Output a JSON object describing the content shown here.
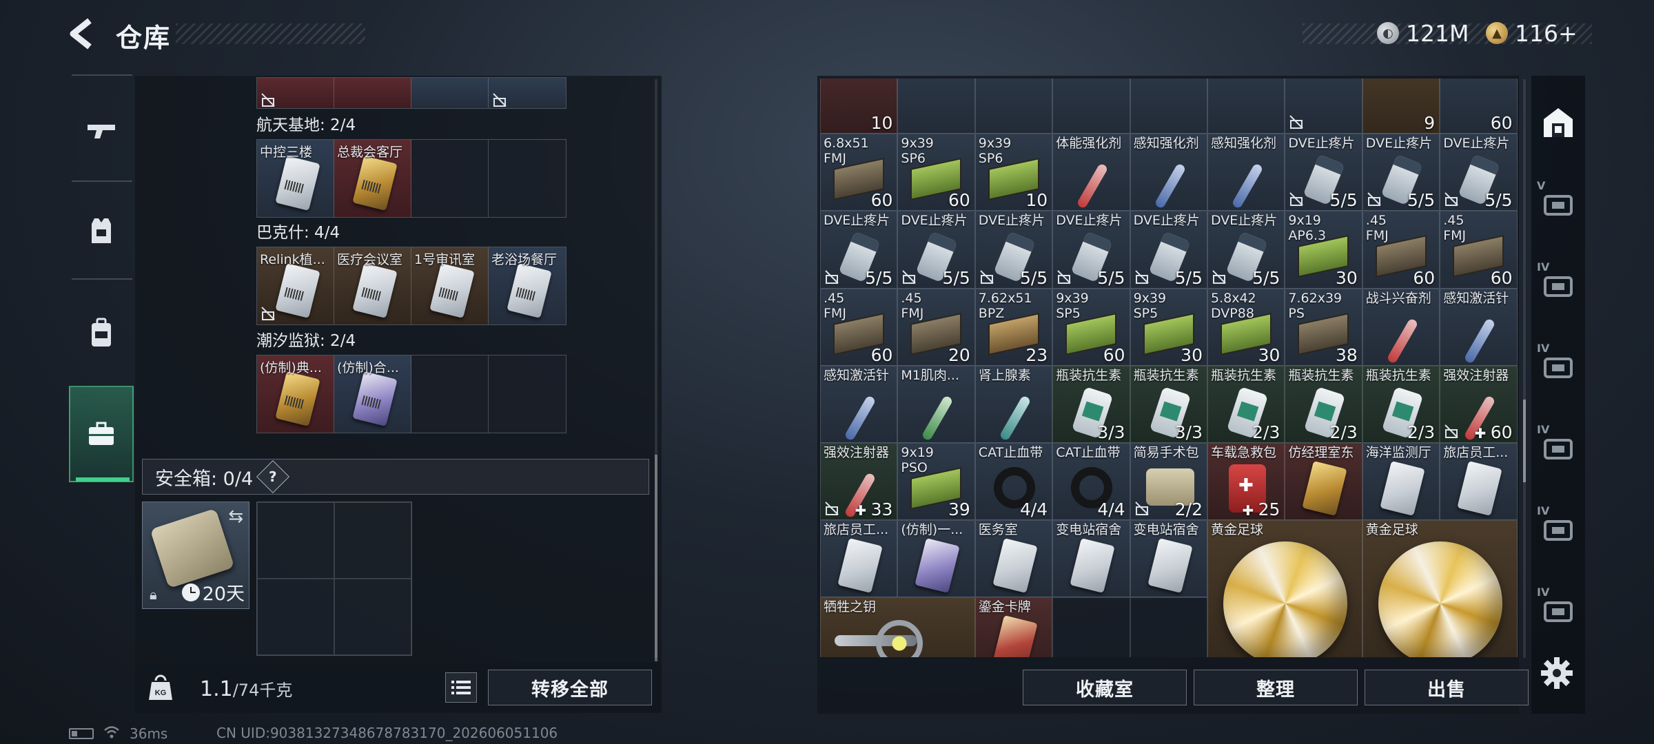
{
  "header": {
    "title": "仓库",
    "currency": [
      {
        "icon": "silver-coin-icon",
        "value": "121M"
      },
      {
        "icon": "gold-coin-icon",
        "value": "116+"
      }
    ]
  },
  "left_nav": [
    {
      "icon": "gun-icon",
      "active": false
    },
    {
      "icon": "vest-icon",
      "active": false
    },
    {
      "icon": "backpack-icon",
      "active": false
    },
    {
      "icon": "briefcase-icon",
      "active": true
    }
  ],
  "key_groups": [
    {
      "label": "航天基地: 2/4",
      "cells": [
        {
          "name": "中控三楼",
          "card": "white",
          "bg": "blue"
        },
        {
          "name": "总裁会客厅",
          "card": "gold",
          "bg": "red"
        },
        {
          "name": "",
          "card": "",
          "bg": "empty"
        },
        {
          "name": "",
          "card": "",
          "bg": "empty"
        }
      ]
    },
    {
      "label": "巴克什: 4/4",
      "cells": [
        {
          "name": "Relink植...",
          "card": "white",
          "bg": "brown",
          "locked": true
        },
        {
          "name": "医疗会议室",
          "card": "white",
          "bg": "brown"
        },
        {
          "name": "1号审讯室",
          "card": "white",
          "bg": "brown"
        },
        {
          "name": "老浴场餐厅",
          "card": "white",
          "bg": "blue"
        }
      ]
    },
    {
      "label": "潮汐监狱: 2/4",
      "cells": [
        {
          "name": "(仿制)典...",
          "card": "gold",
          "bg": "red"
        },
        {
          "name": "(仿制)合...",
          "card": "purple",
          "bg": "blue"
        },
        {
          "name": "",
          "card": "",
          "bg": "empty"
        },
        {
          "name": "",
          "card": "",
          "bg": "empty"
        }
      ]
    }
  ],
  "safe_box": {
    "label": "安全箱: 0/4",
    "help": "?",
    "timer": "20天"
  },
  "footer_left": {
    "weight_value": "1.1",
    "weight_max": "/74千克",
    "transfer_all": "转移全部"
  },
  "footer_right": {
    "collection": "收藏室",
    "organize": "整理",
    "sell": "出售"
  },
  "inventory": [
    {
      "row": 0,
      "col": 0,
      "name": "",
      "qty": "10",
      "kind": "ammo-partial",
      "color": "red"
    },
    {
      "row": 0,
      "col": 1,
      "name": "",
      "qty": "",
      "kind": "partial",
      "color": "blue"
    },
    {
      "row": 0,
      "col": 2,
      "name": "",
      "qty": "",
      "kind": "partial",
      "color": "blue"
    },
    {
      "row": 0,
      "col": 3,
      "name": "",
      "qty": "",
      "kind": "partial",
      "color": "blue"
    },
    {
      "row": 0,
      "col": 4,
      "name": "",
      "qty": "",
      "kind": "partial",
      "color": "blue"
    },
    {
      "row": 0,
      "col": 5,
      "name": "",
      "qty": "",
      "kind": "partial",
      "color": "blue"
    },
    {
      "row": 0,
      "col": 6,
      "name": "",
      "qty": "",
      "kind": "partial",
      "color": "blue",
      "locked": true
    },
    {
      "row": 0,
      "col": 7,
      "name": "",
      "qty": "9",
      "kind": "ammo-partial",
      "color": "gold"
    },
    {
      "row": 0,
      "col": 8,
      "name": "",
      "qty": "60",
      "kind": "ammo-partial",
      "color": "blue"
    },
    {
      "row": 1,
      "col": 0,
      "name": "6.8x51\nFMJ",
      "qty": "60",
      "kind": "ammo",
      "ammo": "brown",
      "color": "blue"
    },
    {
      "row": 1,
      "col": 1,
      "name": "9x39\nSP6",
      "qty": "60",
      "kind": "ammo",
      "ammo": "green",
      "color": "blue"
    },
    {
      "row": 1,
      "col": 2,
      "name": "9x39\nSP6",
      "qty": "10",
      "kind": "ammo",
      "ammo": "green",
      "color": "blue"
    },
    {
      "row": 1,
      "col": 3,
      "name": "体能强化剂",
      "qty": "",
      "kind": "syringe",
      "syr": "red",
      "color": "blue"
    },
    {
      "row": 1,
      "col": 4,
      "name": "感知强化剂",
      "qty": "",
      "kind": "syringe",
      "syr": "blue",
      "color": "blue"
    },
    {
      "row": 1,
      "col": 5,
      "name": "感知强化剂",
      "qty": "",
      "kind": "syringe",
      "syr": "blue",
      "color": "blue"
    },
    {
      "row": 1,
      "col": 6,
      "name": "DVE止疼片",
      "qty": "5/5",
      "kind": "pill",
      "color": "blue",
      "locked": true
    },
    {
      "row": 1,
      "col": 7,
      "name": "DVE止疼片",
      "qty": "5/5",
      "kind": "pill",
      "color": "blue",
      "locked": true
    },
    {
      "row": 1,
      "col": 8,
      "name": "DVE止疼片",
      "qty": "5/5",
      "kind": "pill",
      "color": "blue",
      "locked": true
    },
    {
      "row": 2,
      "col": 0,
      "name": "DVE止疼片",
      "qty": "5/5",
      "kind": "pill",
      "color": "blue",
      "locked": true
    },
    {
      "row": 2,
      "col": 1,
      "name": "DVE止疼片",
      "qty": "5/5",
      "kind": "pill",
      "color": "blue",
      "locked": true
    },
    {
      "row": 2,
      "col": 2,
      "name": "DVE止疼片",
      "qty": "5/5",
      "kind": "pill",
      "color": "blue",
      "locked": true
    },
    {
      "row": 2,
      "col": 3,
      "name": "DVE止疼片",
      "qty": "5/5",
      "kind": "pill",
      "color": "blue",
      "locked": true
    },
    {
      "row": 2,
      "col": 4,
      "name": "DVE止疼片",
      "qty": "5/5",
      "kind": "pill",
      "color": "blue",
      "locked": true
    },
    {
      "row": 2,
      "col": 5,
      "name": "DVE止疼片",
      "qty": "5/5",
      "kind": "pill",
      "color": "blue",
      "locked": true
    },
    {
      "row": 2,
      "col": 6,
      "name": "9x19\nAP6.3",
      "qty": "30",
      "kind": "ammo",
      "ammo": "green",
      "color": "blue"
    },
    {
      "row": 2,
      "col": 7,
      "name": ".45\nFMJ",
      "qty": "60",
      "kind": "ammo",
      "ammo": "brown",
      "color": "blue"
    },
    {
      "row": 2,
      "col": 8,
      "name": ".45\nFMJ",
      "qty": "60",
      "kind": "ammo",
      "ammo": "brown",
      "color": "blue"
    },
    {
      "row": 3,
      "col": 0,
      "name": ".45\nFMJ",
      "qty": "60",
      "kind": "ammo",
      "ammo": "brown",
      "color": "blue"
    },
    {
      "row": 3,
      "col": 1,
      "name": ".45\nFMJ",
      "qty": "20",
      "kind": "ammo",
      "ammo": "brown",
      "color": "blue"
    },
    {
      "row": 3,
      "col": 2,
      "name": "7.62x51\nBPZ",
      "qty": "23",
      "kind": "ammo",
      "ammo": "olive",
      "color": "blue"
    },
    {
      "row": 3,
      "col": 3,
      "name": "9x39\nSP5",
      "qty": "60",
      "kind": "ammo",
      "ammo": "green",
      "color": "blue"
    },
    {
      "row": 3,
      "col": 4,
      "name": "9x39\nSP5",
      "qty": "30",
      "kind": "ammo",
      "ammo": "green",
      "color": "blue"
    },
    {
      "row": 3,
      "col": 5,
      "name": "5.8x42\nDVP88",
      "qty": "30",
      "kind": "ammo",
      "ammo": "green",
      "color": "blue"
    },
    {
      "row": 3,
      "col": 6,
      "name": "7.62x39\nPS",
      "qty": "38",
      "kind": "ammo",
      "ammo": "brown",
      "color": "blue"
    },
    {
      "row": 3,
      "col": 7,
      "name": "战斗兴奋剂",
      "qty": "",
      "kind": "syringe",
      "syr": "red",
      "color": "blue"
    },
    {
      "row": 3,
      "col": 8,
      "name": "感知激活针",
      "qty": "",
      "kind": "syringe",
      "syr": "blue",
      "color": "blue"
    },
    {
      "row": 4,
      "col": 0,
      "name": "感知激活针",
      "qty": "",
      "kind": "syringe",
      "syr": "blue",
      "color": "blue"
    },
    {
      "row": 4,
      "col": 1,
      "name": "M1肌肉...",
      "qty": "",
      "kind": "syringe",
      "syr": "green",
      "color": "blue"
    },
    {
      "row": 4,
      "col": 2,
      "name": "肾上腺素",
      "qty": "",
      "kind": "syringe",
      "syr": "teal",
      "color": "blue"
    },
    {
      "row": 4,
      "col": 3,
      "name": "瓶装抗生素",
      "qty": "3/3",
      "kind": "bottle",
      "color": "green"
    },
    {
      "row": 4,
      "col": 4,
      "name": "瓶装抗生素",
      "qty": "3/3",
      "kind": "bottle",
      "color": "green"
    },
    {
      "row": 4,
      "col": 5,
      "name": "瓶装抗生素",
      "qty": "2/3",
      "kind": "bottle",
      "color": "green"
    },
    {
      "row": 4,
      "col": 6,
      "name": "瓶装抗生素",
      "qty": "2/3",
      "kind": "bottle",
      "color": "green"
    },
    {
      "row": 4,
      "col": 7,
      "name": "瓶装抗生素",
      "qty": "2/3",
      "kind": "bottle",
      "color": "green"
    },
    {
      "row": 4,
      "col": 8,
      "name": "强效注射器",
      "qty": "60",
      "kind": "syringe",
      "syr": "red",
      "color": "green",
      "locked": true,
      "plus": true
    },
    {
      "row": 5,
      "col": 0,
      "name": "强效注射器",
      "qty": "33",
      "kind": "syringe",
      "syr": "red",
      "color": "green",
      "locked": true,
      "plus": true
    },
    {
      "row": 5,
      "col": 1,
      "name": "9x19\nPSO",
      "qty": "39",
      "kind": "ammo",
      "ammo": "green",
      "color": "blue"
    },
    {
      "row": 5,
      "col": 2,
      "name": "CAT止血带",
      "qty": "4/4",
      "kind": "tourniquet",
      "color": "blue"
    },
    {
      "row": 5,
      "col": 3,
      "name": "CAT止血带",
      "qty": "4/4",
      "kind": "tourniquet",
      "color": "blue"
    },
    {
      "row": 5,
      "col": 4,
      "name": "简易手术包",
      "qty": "2/2",
      "kind": "medbag",
      "color": "blue",
      "locked": true
    },
    {
      "row": 5,
      "col": 5,
      "name": "车载急救包",
      "qty": "25",
      "kind": "firstaid",
      "color": "red",
      "plus": true
    },
    {
      "row": 5,
      "col": 6,
      "name": "仿经理室东",
      "qty": "",
      "kind": "card",
      "card": "gold",
      "color": "red"
    },
    {
      "row": 5,
      "col": 7,
      "name": "海洋监测厅",
      "qty": "",
      "kind": "card",
      "card": "white",
      "color": "blue"
    },
    {
      "row": 5,
      "col": 8,
      "name": "旅店员工...",
      "qty": "",
      "kind": "card",
      "card": "white",
      "color": "blue"
    },
    {
      "row": 6,
      "col": 0,
      "name": "旅店员工...",
      "qty": "",
      "kind": "card",
      "card": "white",
      "color": "blue"
    },
    {
      "row": 6,
      "col": 1,
      "name": "(仿制)一...",
      "qty": "",
      "kind": "card",
      "card": "purple",
      "color": "blue"
    },
    {
      "row": 6,
      "col": 2,
      "name": "医务室",
      "qty": "",
      "kind": "card",
      "card": "white",
      "color": "blue"
    },
    {
      "row": 6,
      "col": 3,
      "name": "变电站宿舍",
      "qty": "",
      "kind": "card",
      "card": "white",
      "color": "blue"
    },
    {
      "row": 6,
      "col": 4,
      "name": "变电站宿舍",
      "qty": "",
      "kind": "card",
      "card": "white",
      "color": "blue"
    },
    {
      "row": 7,
      "col": 0,
      "name": "牺牲之钥",
      "qty": "",
      "kind": "key",
      "color": "gold",
      "wide": 2
    },
    {
      "row": 7,
      "col": 2,
      "name": "鎏金卡牌",
      "qty": "",
      "kind": "card",
      "card": "redgold",
      "color": "red"
    },
    {
      "row": 7,
      "col": 3,
      "name": "",
      "qty": "",
      "kind": "empty",
      "color": "empty"
    },
    {
      "row": 7,
      "col": 4,
      "name": "",
      "qty": "",
      "kind": "empty",
      "color": "empty"
    },
    {
      "row": 6,
      "col": 5,
      "name": "黄金足球",
      "qty": "",
      "kind": "ball",
      "color": "gold",
      "wide": 2,
      "tall": 2
    },
    {
      "row": 6,
      "col": 7,
      "name": "黄金足球",
      "qty": "",
      "kind": "ball",
      "color": "gold",
      "wide": 2,
      "tall": 2
    }
  ],
  "right_nav": [
    {
      "icon": "home-base-icon",
      "label": "",
      "active": true
    },
    {
      "icon": "tier-v-case-icon",
      "label": "V"
    },
    {
      "icon": "tier-iv-case-icon",
      "label": "IV"
    },
    {
      "icon": "tier-iv-case-icon",
      "label": "IV"
    },
    {
      "icon": "tier-iv-case-icon",
      "label": "IV"
    },
    {
      "icon": "tier-iv-case-icon",
      "label": "IV"
    },
    {
      "icon": "tier-iv-case-icon",
      "label": "IV"
    }
  ],
  "status": {
    "ping": "36ms",
    "uid": "CN UID:9038132734867878317­0_202606051106"
  }
}
